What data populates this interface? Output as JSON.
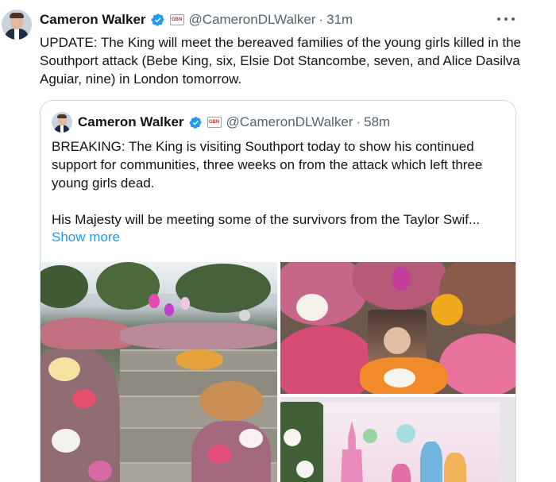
{
  "tweet": {
    "author_name": "Cameron Walker",
    "handle": "@CameronDLWalker",
    "separator": "·",
    "time": "31m",
    "affiliation_badge": "GBN",
    "text": "UPDATE: The King will meet the bereaved families of the young girls killed in the Southport attack (Bebe King, six, Elsie Dot Stancombe, seven, and Alice Dasilva Aguiar, nine) in London tomorrow.",
    "more_icon": "more-horizontal-icon"
  },
  "quoted_tweet": {
    "author_name": "Cameron Walker",
    "handle": "@CameronDLWalker",
    "separator": "·",
    "time": "58m",
    "affiliation_badge": "GBN",
    "paragraph_1": "BREAKING: The King is visiting Southport today to show his continued support for communities, three weeks on from the attack which left three young girls dead.",
    "paragraph_2": "His Majesty will be meeting some of the survivors from the Taylor Swif...",
    "show_more": "Show more"
  },
  "colors": {
    "text": "#0f1419",
    "secondary": "#536471",
    "link": "#1d9bf0",
    "verified": "#1d9bf0",
    "border": "#cfd9de"
  }
}
